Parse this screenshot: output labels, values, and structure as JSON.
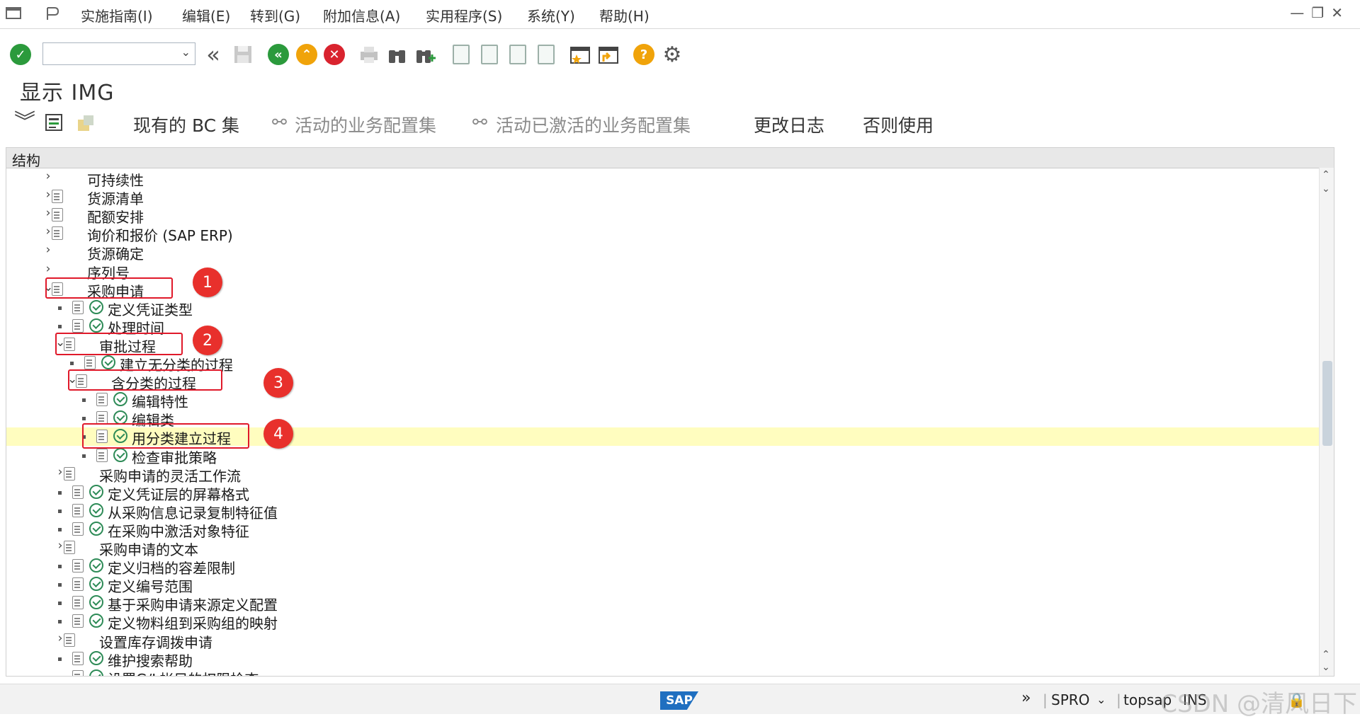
{
  "menu": {
    "items": [
      "实施指南(I)",
      "编辑(E)",
      "转到(G)",
      "附加信息(A)",
      "实用程序(S)",
      "系统(Y)",
      "帮助(H)"
    ]
  },
  "toolbar": {
    "command_value": "",
    "icons": [
      "enter-icon",
      "back-double-icon",
      "save-icon",
      "back-icon",
      "exit-icon",
      "cancel-icon",
      "print-icon",
      "find-icon",
      "find-next-icon",
      "first-page-icon",
      "prev-page-icon",
      "next-page-icon",
      "last-page-icon",
      "create-session-icon",
      "shortcut-icon",
      "help-icon",
      "settings-icon"
    ]
  },
  "page_title": "显示 IMG",
  "app_toolbar": {
    "existing_bc_sets": "现有的 BC 集",
    "active_bc_sets": "活动的业务配置集",
    "activated_bc_sets": "活动已激活的业务配置集",
    "change_log": "更改日志",
    "where_used": "否则使用"
  },
  "tree": {
    "header": "结构",
    "rows": [
      {
        "label": "可持续性",
        "toggle": "›",
        "level": 0
      },
      {
        "label": "货源清单",
        "toggle": "›",
        "level": 0
      },
      {
        "label": "配额安排",
        "toggle": "›",
        "level": 0
      },
      {
        "label": "询价和报价 (SAP ERP)",
        "toggle": "›",
        "level": 0
      },
      {
        "label": "货源确定",
        "toggle": "›",
        "level": 0
      },
      {
        "label": "序列号",
        "toggle": "›",
        "level": 0
      },
      {
        "label": "采购申请",
        "toggle": "⌄",
        "level": 0
      },
      {
        "label": "定义凭证类型",
        "toggle": "",
        "level": 1
      },
      {
        "label": "处理时间",
        "toggle": "",
        "level": 1
      },
      {
        "label": "审批过程",
        "toggle": "⌄",
        "level": 1
      },
      {
        "label": "建立无分类的过程",
        "toggle": "",
        "level": 2
      },
      {
        "label": "含分类的过程",
        "toggle": "⌄",
        "level": 2
      },
      {
        "label": "编辑特性",
        "toggle": "",
        "level": 3
      },
      {
        "label": "编辑类",
        "toggle": "",
        "level": 3
      },
      {
        "label": "用分类建立过程",
        "toggle": "",
        "level": 3,
        "selected": true
      },
      {
        "label": "检查审批策略",
        "toggle": "",
        "level": 3
      },
      {
        "label": "采购申请的灵活工作流",
        "toggle": "›",
        "level": 1
      },
      {
        "label": "定义凭证层的屏幕格式",
        "toggle": "",
        "level": 1
      },
      {
        "label": "从采购信息记录复制特征值",
        "toggle": "",
        "level": 1
      },
      {
        "label": "在采购中激活对象特征",
        "toggle": "",
        "level": 1
      },
      {
        "label": "采购申请的文本",
        "toggle": "›",
        "level": 1
      },
      {
        "label": "定义归档的容差限制",
        "toggle": "",
        "level": 1
      },
      {
        "label": "定义编号范围",
        "toggle": "",
        "level": 1
      },
      {
        "label": "基于采购申请来源定义配置",
        "toggle": "",
        "level": 1
      },
      {
        "label": "定义物料组到采购组的映射",
        "toggle": "",
        "level": 1
      },
      {
        "label": "设置库存调拨申请",
        "toggle": "›",
        "level": 1
      },
      {
        "label": "维护搜索帮助",
        "toggle": "",
        "level": 1
      },
      {
        "label": "设置G/L帐目的权限检查",
        "toggle": "",
        "level": 1
      }
    ]
  },
  "annotations": [
    "1",
    "2",
    "3",
    "4"
  ],
  "status": {
    "sap_logo": "SAP",
    "transaction": "SPRO",
    "system": "topsap",
    "mode": "INS",
    "watermark": "CSDN @清风日下"
  }
}
